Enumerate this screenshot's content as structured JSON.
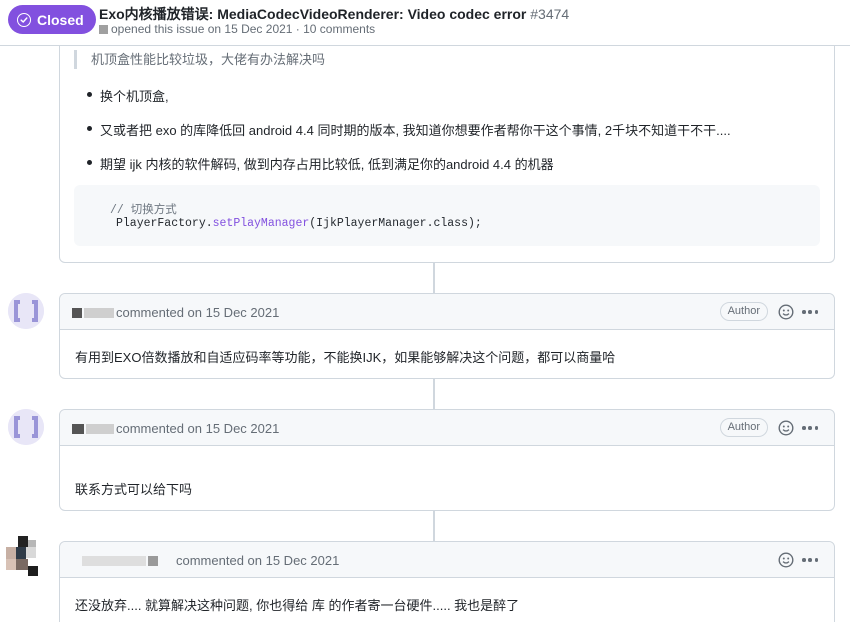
{
  "header": {
    "state": "Closed",
    "title": "Exo内核播放错误: MediaCodecVideoRenderer: Video codec error",
    "issue_number": "#3474",
    "meta": "opened this issue on 15 Dec 2021 · 10 comments"
  },
  "first_comment": {
    "quote": "机顶盒性能比较垃圾，大佬有办法解决吗",
    "bullets": [
      "换个机顶盒,",
      "又或者把 exo 的库降低回 android 4.4 同时期的版本, 我知道你想要作者帮你干这个事情, 2千块不知道干不干....",
      "期望 ijk 内核的软件解码, 做到内存占用比较低, 低到满足你的android 4.4 的机器"
    ],
    "code": {
      "comment": "// 切换方式",
      "object": "PlayerFactory.",
      "method": "setPlayManager",
      "args": "(IjkPlayerManager.class);"
    }
  },
  "comments": [
    {
      "meta": "commented on 15 Dec 2021",
      "badge": "Author",
      "body": "有用到EXO倍数播放和自适应码率等功能，不能换IJK，如果能够解决这个问题，都可以商量哈"
    },
    {
      "meta": "commented on 15 Dec 2021",
      "badge": "Author",
      "body": "联系方式可以给下吗"
    },
    {
      "meta": "commented on 15 Dec 2021",
      "body": "还没放弃.... 就算解决这种问题, 你也得给 库 的作者寄一台硬件..... 我也是醉了"
    }
  ],
  "colors": {
    "closed_purple": "#8250df",
    "border": "#d0d7de",
    "muted_text": "#656d76",
    "avatar_bg": "#e8e6f7",
    "avatar_fg": "#9a95d8"
  },
  "icons": {
    "state": "check-circle-icon",
    "reaction": "smiley-icon",
    "menu": "kebab-horizontal-icon",
    "avatar": "identicon-bracket"
  }
}
